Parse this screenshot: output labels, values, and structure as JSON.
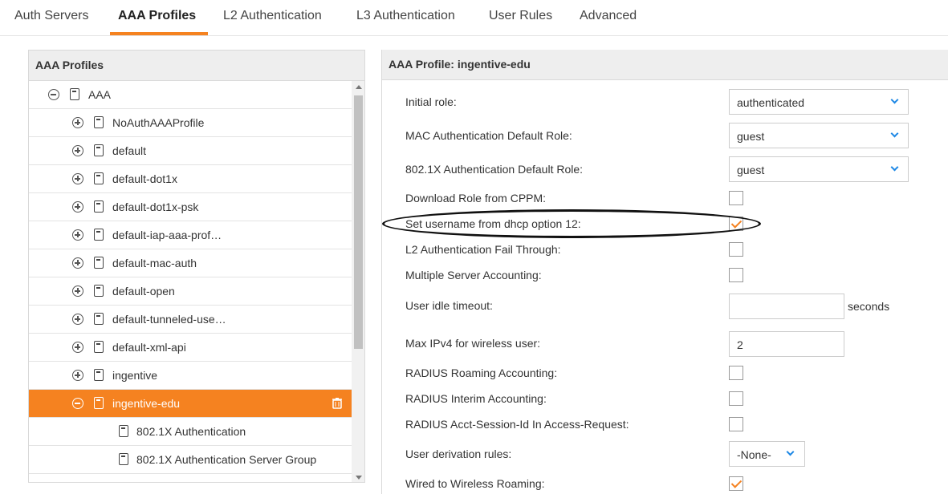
{
  "tabs": [
    {
      "label": "Auth Servers",
      "active": false
    },
    {
      "label": "AAA Profiles",
      "active": true
    },
    {
      "label": "L2 Authentication",
      "active": false
    },
    {
      "label": "L3 Authentication",
      "active": false
    },
    {
      "label": "User Rules",
      "active": false
    },
    {
      "label": "Advanced",
      "active": false
    }
  ],
  "colors": {
    "accent": "#f58220",
    "chevron": "#1e88e5"
  },
  "left_panel": {
    "title": "AAA Profiles",
    "tree": [
      {
        "label": "AAA",
        "level": 0,
        "toggle": "minus"
      },
      {
        "label": "NoAuthAAAProfile",
        "level": 1,
        "toggle": "plus"
      },
      {
        "label": "default",
        "level": 1,
        "toggle": "plus"
      },
      {
        "label": "default-dot1x",
        "level": 1,
        "toggle": "plus"
      },
      {
        "label": "default-dot1x-psk",
        "level": 1,
        "toggle": "plus"
      },
      {
        "label": "default-iap-aaa-prof…",
        "level": 1,
        "toggle": "plus"
      },
      {
        "label": "default-mac-auth",
        "level": 1,
        "toggle": "plus"
      },
      {
        "label": "default-open",
        "level": 1,
        "toggle": "plus"
      },
      {
        "label": "default-tunneled-use…",
        "level": 1,
        "toggle": "plus"
      },
      {
        "label": "default-xml-api",
        "level": 1,
        "toggle": "plus"
      },
      {
        "label": "ingentive",
        "level": 1,
        "toggle": "plus"
      },
      {
        "label": "ingentive-edu",
        "level": 1,
        "toggle": "minus",
        "selected": true
      },
      {
        "label": "802.1X Authentication",
        "level": 2
      },
      {
        "label": "802.1X Authentication Server Group",
        "level": 2
      }
    ]
  },
  "right_panel": {
    "title": "AAA Profile: ingentive-edu",
    "fields": {
      "initial_role": {
        "label": "Initial role:",
        "value": "authenticated"
      },
      "mac_default_role": {
        "label": "MAC Authentication Default Role:",
        "value": "guest"
      },
      "dot1x_default_role": {
        "label": "802.1X Authentication Default Role:",
        "value": "guest"
      },
      "download_role_cppm": {
        "label": "Download Role from CPPM:",
        "checked": false
      },
      "username_dhcp12": {
        "label": "Set username from dhcp option 12:",
        "checked": true
      },
      "l2_fail_through": {
        "label": "L2 Authentication Fail Through:",
        "checked": false
      },
      "multiple_server_accounting": {
        "label": "Multiple Server Accounting:",
        "checked": false
      },
      "user_idle_timeout": {
        "label": "User idle timeout:",
        "value": "",
        "unit": "seconds"
      },
      "max_ipv4": {
        "label": "Max IPv4 for wireless user:",
        "value": "2"
      },
      "radius_roaming": {
        "label": "RADIUS Roaming Accounting:",
        "checked": false
      },
      "radius_interim": {
        "label": "RADIUS Interim Accounting:",
        "checked": false
      },
      "radius_session_id": {
        "label": "RADIUS Acct-Session-Id In Access-Request:",
        "checked": false
      },
      "user_derivation": {
        "label": "User derivation rules:",
        "value": "-None-"
      },
      "wired_roaming": {
        "label": "Wired to Wireless Roaming:",
        "checked": true
      }
    }
  }
}
